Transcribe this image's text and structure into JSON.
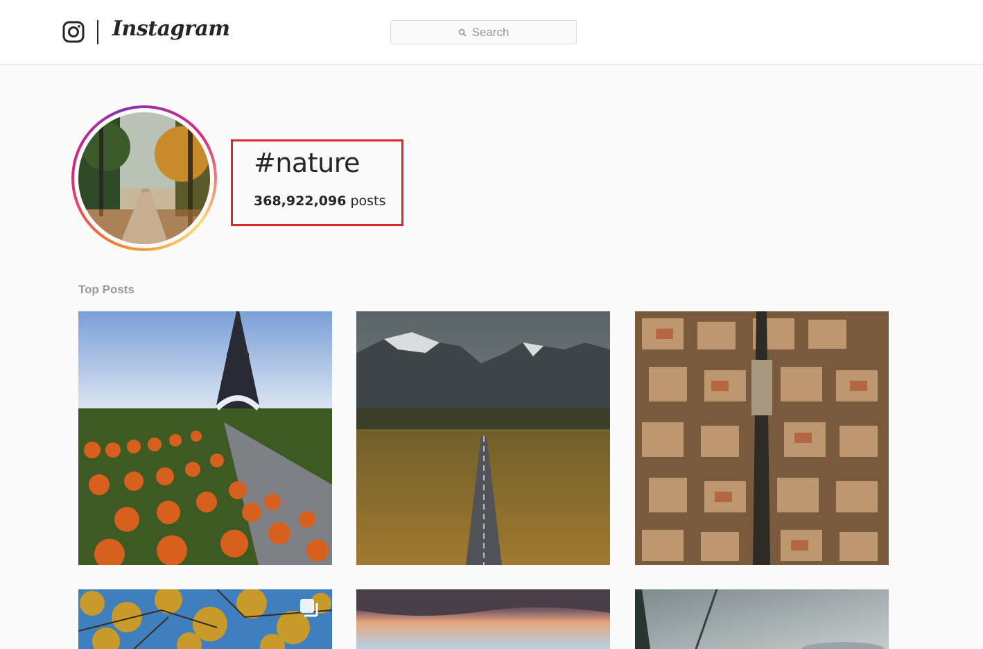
{
  "header": {
    "wordmark": "Instagram",
    "search": {
      "placeholder": "Search"
    }
  },
  "hashtag": {
    "title": "#nature",
    "post_count": "368,922,096",
    "post_label": "posts"
  },
  "top_posts": {
    "label": "Top Posts",
    "items": [
      {
        "icon": "eiffel-tower-pumpkins-photo"
      },
      {
        "icon": "mountain-road-photo"
      },
      {
        "icon": "aerial-city-photo"
      },
      {
        "icon": "autumn-tree-photo",
        "badge": "multiple-photos-icon"
      },
      {
        "icon": "sunset-sky-photo"
      },
      {
        "icon": "misty-forest-photo"
      }
    ]
  },
  "colors": {
    "highlight_border": "#e0242b",
    "gradient_ring": [
      "#f58529",
      "#dd2a7b",
      "#8134af",
      "#feda77"
    ]
  }
}
